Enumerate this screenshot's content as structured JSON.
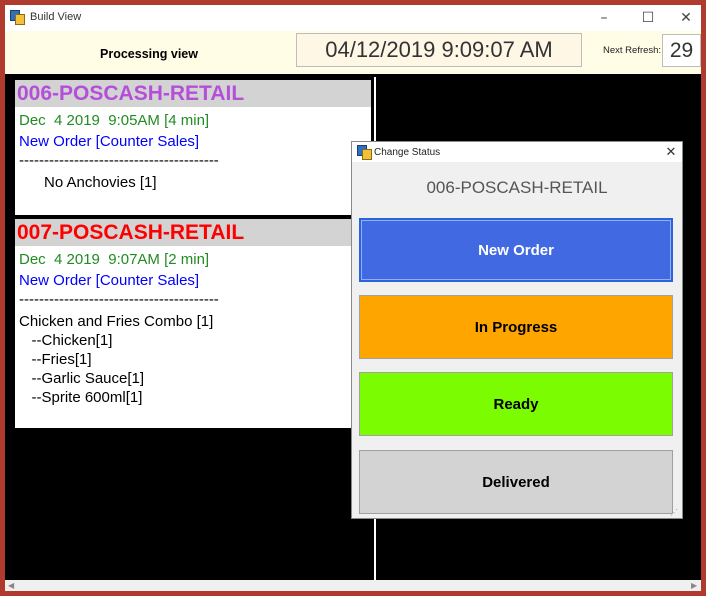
{
  "window": {
    "title": "Build View",
    "minimize_glyph": "–",
    "maximize_glyph": "☐",
    "close_glyph": "✕"
  },
  "header": {
    "processing_label": "Processing view",
    "clock": "04/12/2019 9:09:07 AM",
    "next_refresh_label": "Next Refresh:",
    "next_refresh_value": "29"
  },
  "orders": [
    {
      "title": "006-POSCASH-RETAIL",
      "title_color": "#b44fd9",
      "time": "Dec  4 2019  9:05AM [4 min]",
      "status": "New Order [Counter Sales]",
      "separator": "----------------------------------------",
      "items": [
        "      No Anchovies [1]"
      ]
    },
    {
      "title": "007-POSCASH-RETAIL",
      "title_color": "#ff0000",
      "time": "Dec  4 2019  9:07AM [2 min]",
      "status": "New Order [Counter Sales]",
      "separator": "----------------------------------------",
      "items": [
        "Chicken and Fries Combo [1]",
        "   --Chicken[1]",
        "   --Fries[1]",
        "   --Garlic Sauce[1]",
        "   --Sprite 600ml[1]"
      ]
    }
  ],
  "colors": {
    "time_green": "#228b22",
    "status_blue": "#0000ff"
  },
  "dialog": {
    "title": "Change Status",
    "close_glyph": "✕",
    "heading": "006-POSCASH-RETAIL",
    "buttons": {
      "new_order": "New Order",
      "in_progress": "In Progress",
      "ready": "Ready",
      "delivered": "Delivered"
    }
  },
  "scrollbar": {
    "left_glyph": "◀",
    "right_glyph": "▶"
  }
}
